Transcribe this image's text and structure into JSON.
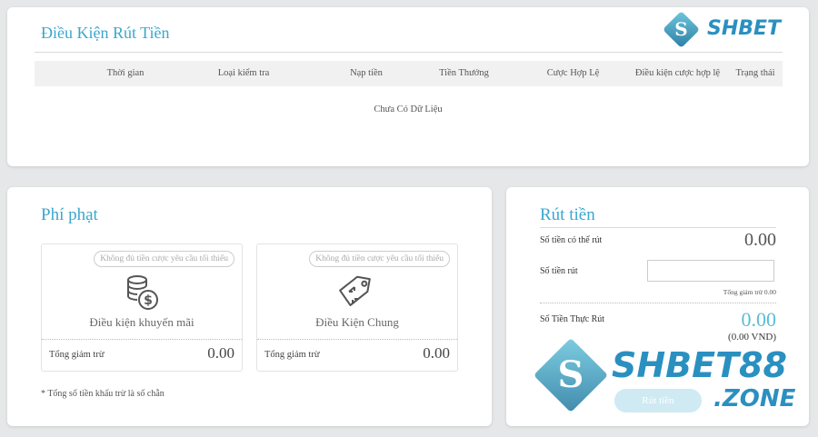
{
  "withdraw_conditions": {
    "title": "Điều Kiện Rút Tiền",
    "columns": [
      "Thời gian",
      "Loại kiểm tra",
      "Nạp tiền",
      "Tiền Thưởng",
      "Cược Hợp Lệ",
      "Điều kiện cược hợp lệ",
      "Trạng thái"
    ],
    "empty_text": "Chưa Có Dữ Liệu"
  },
  "logo_small": {
    "letter": "S",
    "text": "SHBET"
  },
  "penalty": {
    "title": "Phí phạt",
    "cards": [
      {
        "badge": "Không đủ tiền cược yêu cầu tối thiểu",
        "label": "Điều kiện khuyến mãi",
        "total_label": "Tổng giảm trừ",
        "total_value": "0.00",
        "icon": "coins-dollar-icon"
      },
      {
        "badge": "Không đủ tiền cược yêu cầu tối thiểu",
        "label": "Điều Kiện Chung",
        "total_label": "Tổng giảm trừ",
        "total_value": "0.00",
        "icon": "price-tag-exchange-icon"
      }
    ],
    "footnote": "* Tổng số tiền khấu trừ là số chẵn"
  },
  "withdraw": {
    "title": "Rút tiền",
    "available_label": "Số tiền có thể rút",
    "available_value": "0.00",
    "amount_label": "Số tiền rút",
    "amount_value": "",
    "deduction_text": "Tổng giảm trừ 0.00",
    "actual_label": "Số Tiền Thực Rút",
    "actual_value": "0.00",
    "actual_vnd": "(0.00 VND)",
    "button_label": "Rút tiền"
  },
  "logo_big": {
    "letter": "S",
    "text_top": "SHBET88",
    "text_bottom": ".ZONE"
  },
  "colors": {
    "accent": "#3aa7cf",
    "logo": "#2a90c0",
    "background": "#e6e7e8"
  }
}
